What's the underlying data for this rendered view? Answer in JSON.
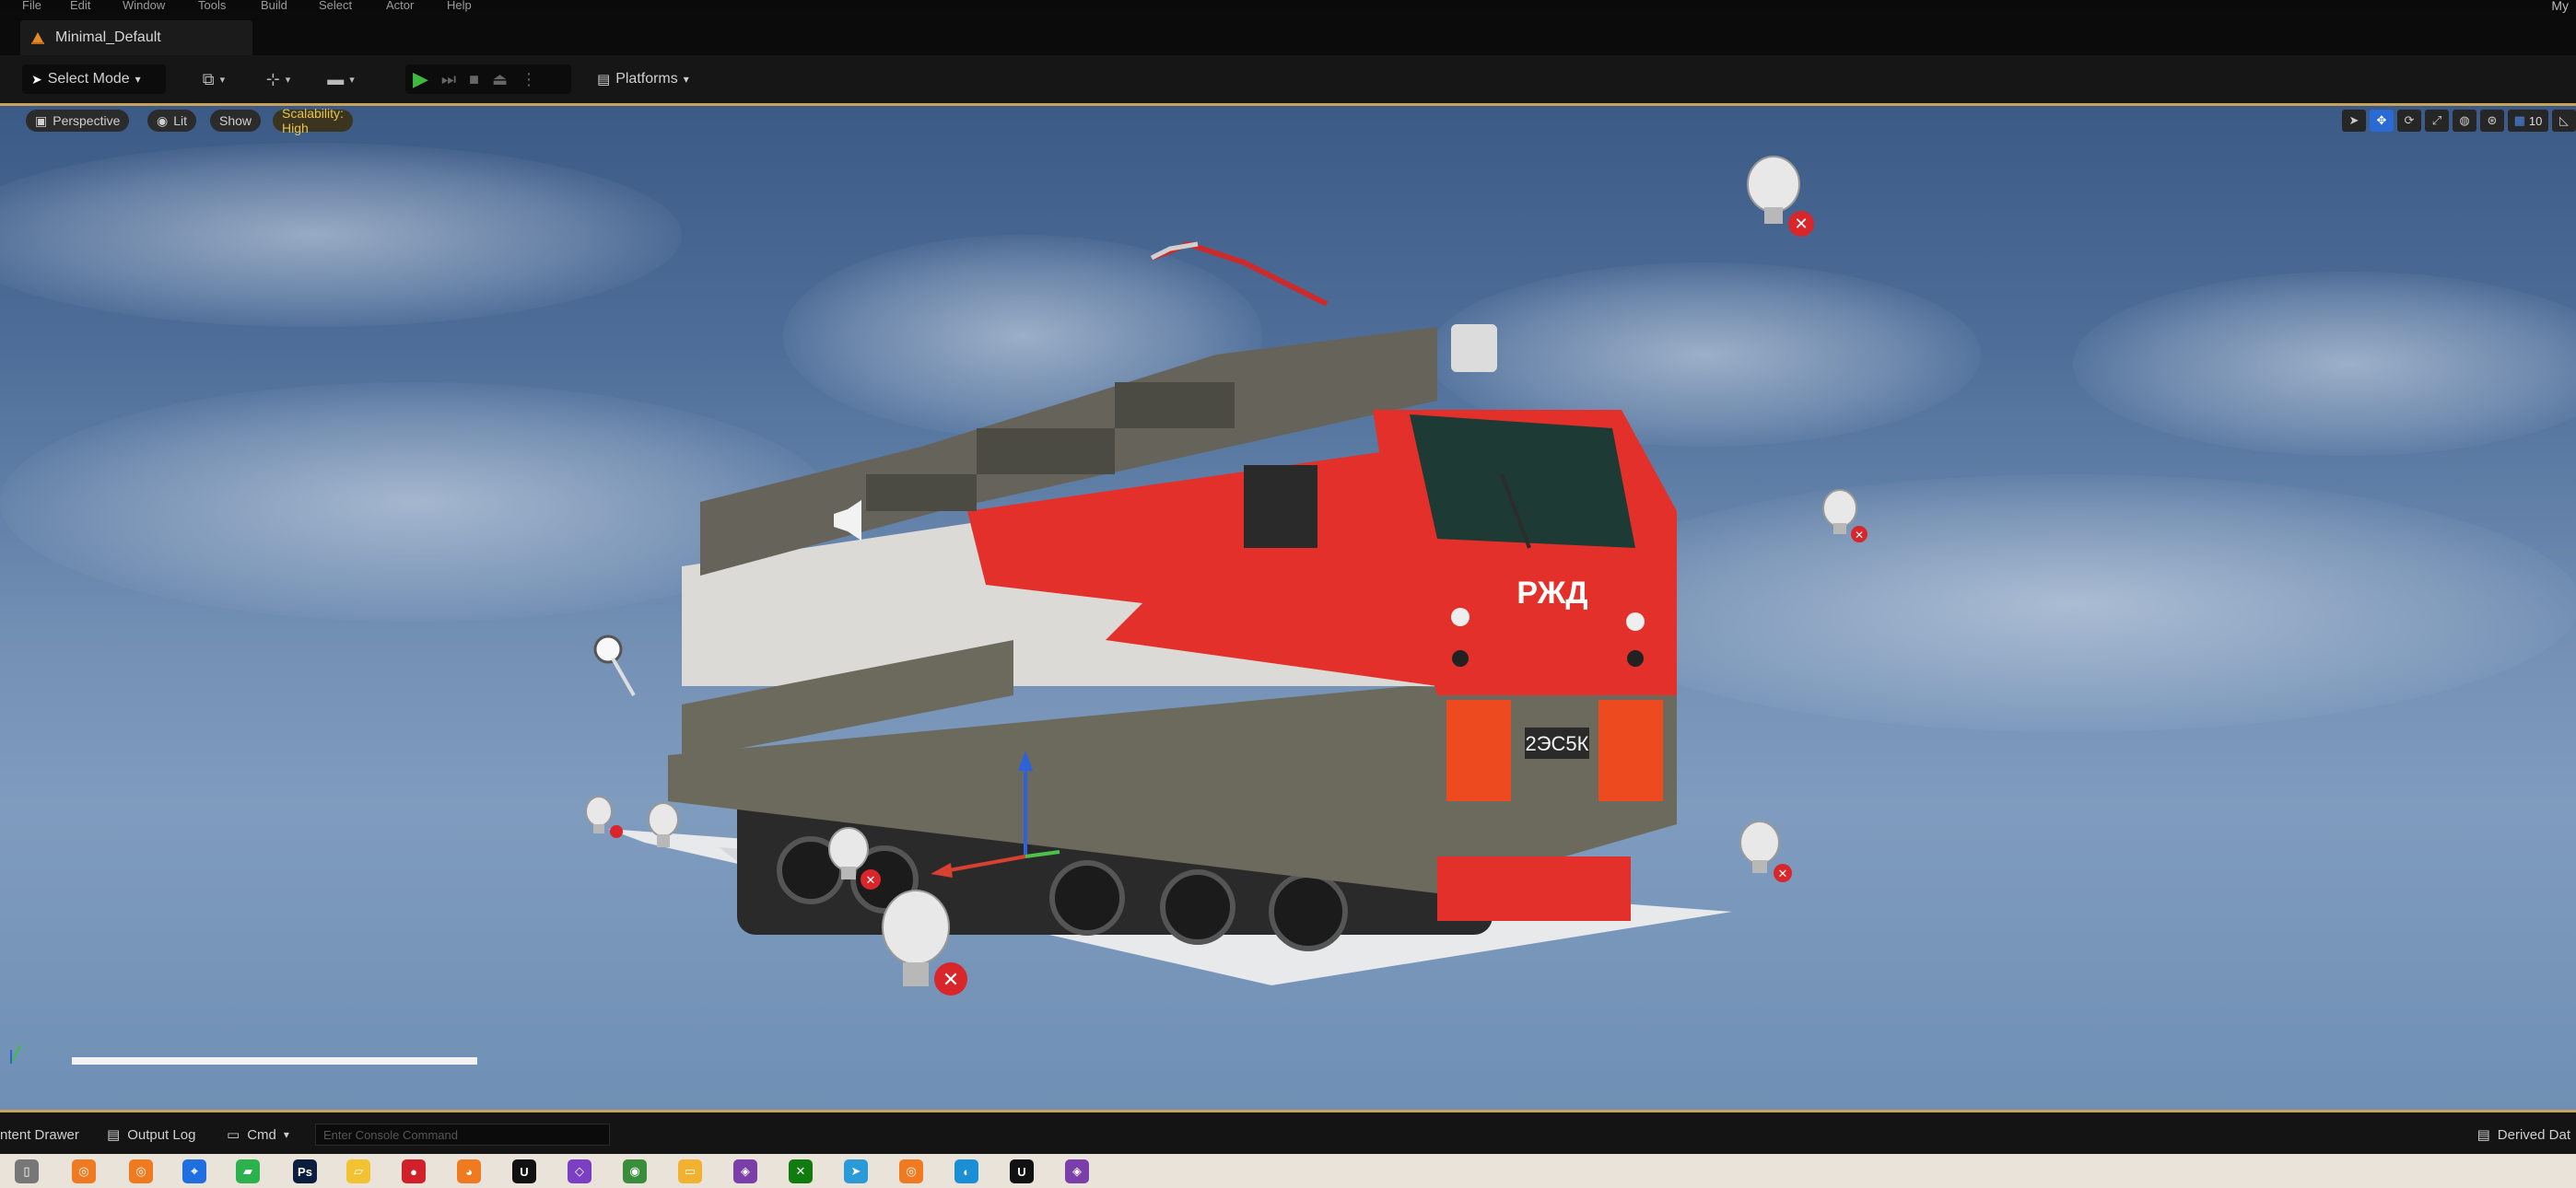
{
  "menu": {
    "items": [
      "File",
      "Edit",
      "Window",
      "Tools",
      "Build",
      "Select",
      "Actor",
      "Help"
    ],
    "user": "My"
  },
  "tab": {
    "title": "Minimal_Default"
  },
  "toolbar": {
    "select_mode": "Select Mode",
    "platforms": "Platforms"
  },
  "viewport": {
    "perspective": "Perspective",
    "lit": "Lit",
    "show": "Show",
    "scalability": "Scalability: High",
    "grid_snap": "10",
    "loco_logo": "РЖД",
    "loco_number": "2ЭС5К"
  },
  "progress": {
    "value": 1.0
  },
  "statusbar": {
    "content_drawer": "ntent Drawer",
    "output_log": "Output Log",
    "cmd": "Cmd",
    "console_placeholder": "Enter Console Command",
    "derived_data": "Derived Dat"
  },
  "colors": {
    "accent_gold": "#c8a15a",
    "play_green": "#3fb93f",
    "loco_red": "#e3302a",
    "loco_grey": "#6b6a5c",
    "selected_blue": "#2a6ad4"
  },
  "taskbar": {
    "icons": [
      "task-view-icon",
      "blender-icon",
      "blender-icon",
      "maps-icon",
      "phone-link-icon",
      "photoshop-icon",
      "file-explorer-icon",
      "red-app-icon",
      "firefox-icon",
      "unreal-engine-icon",
      "visual-studio-icon",
      "chrome-icon",
      "folder-icon",
      "app-icon",
      "xbox-icon",
      "telegram-icon",
      "blender-icon",
      "edge-icon",
      "unreal-engine-icon",
      "app-icon"
    ]
  }
}
